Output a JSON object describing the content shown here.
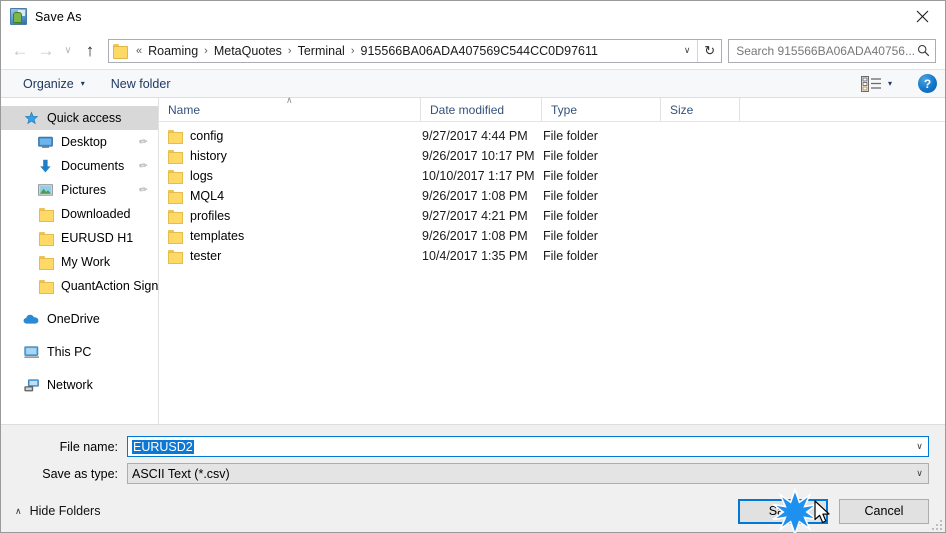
{
  "window": {
    "title": "Save As",
    "app_icon": "save-as-app-icon",
    "close_label": "✕"
  },
  "nav": {
    "back": "←",
    "forward": "→",
    "history": "∨",
    "up": "↑",
    "breadcrumb_prefix": "«",
    "breadcrumbs": [
      "Roaming",
      "MetaQuotes",
      "Terminal",
      "915566BA06ADA407569C544CC0D97611"
    ],
    "separator": "›",
    "dropdown": "∨",
    "refresh": "↻"
  },
  "search": {
    "placeholder": "Search 915566BA06ADA40756...",
    "icon": "search-icon"
  },
  "toolbar": {
    "organize": "Organize",
    "organize_caret": "▾",
    "new_folder": "New folder",
    "view_caret": "▾",
    "help": "?"
  },
  "sidebar": {
    "items": [
      {
        "label": "Quick access",
        "icon": "star-icon",
        "selected": true,
        "indent": false,
        "pinned": false
      },
      {
        "label": "Desktop",
        "icon": "monitor-icon",
        "selected": false,
        "indent": true,
        "pinned": true
      },
      {
        "label": "Documents",
        "icon": "download-arrow-icon",
        "selected": false,
        "indent": true,
        "pinned": true
      },
      {
        "label": "Pictures",
        "icon": "picture-icon",
        "selected": false,
        "indent": true,
        "pinned": true
      },
      {
        "label": "Downloaded",
        "icon": "folder-icon",
        "selected": false,
        "indent": true,
        "pinned": false
      },
      {
        "label": "EURUSD H1",
        "icon": "folder-icon",
        "selected": false,
        "indent": true,
        "pinned": false
      },
      {
        "label": "My Work",
        "icon": "folder-icon",
        "selected": false,
        "indent": true,
        "pinned": false
      },
      {
        "label": "QuantAction Signal",
        "icon": "folder-icon",
        "selected": false,
        "indent": true,
        "pinned": false
      }
    ],
    "groups": [
      {
        "label": "OneDrive",
        "icon": "onedrive-cloud-icon"
      },
      {
        "label": "This PC",
        "icon": "computer-icon"
      },
      {
        "label": "Network",
        "icon": "network-icon"
      }
    ],
    "pin_glyph": "✐"
  },
  "filelist": {
    "columns": [
      "Name",
      "Date modified",
      "Type",
      "Size"
    ],
    "sort_caret": "∧",
    "rows": [
      {
        "name": "config",
        "date": "9/27/2017 4:44 PM",
        "type": "File folder",
        "size": ""
      },
      {
        "name": "history",
        "date": "9/26/2017 10:17 PM",
        "type": "File folder",
        "size": ""
      },
      {
        "name": "logs",
        "date": "10/10/2017 1:17 PM",
        "type": "File folder",
        "size": ""
      },
      {
        "name": "MQL4",
        "date": "9/26/2017 1:08 PM",
        "type": "File folder",
        "size": ""
      },
      {
        "name": "profiles",
        "date": "9/27/2017 4:21 PM",
        "type": "File folder",
        "size": ""
      },
      {
        "name": "templates",
        "date": "9/26/2017 1:08 PM",
        "type": "File folder",
        "size": ""
      },
      {
        "name": "tester",
        "date": "10/4/2017 1:35 PM",
        "type": "File folder",
        "size": ""
      }
    ]
  },
  "form": {
    "filename_label": "File name:",
    "filename_value": "EURUSD2",
    "filetype_label": "Save as type:",
    "filetype_value": "ASCII Text (*.csv)",
    "chevron": "∨"
  },
  "footer": {
    "hide_folders": "Hide Folders",
    "hide_caret": "∧",
    "save": "Save",
    "cancel": "Cancel"
  },
  "colors": {
    "accent": "#0078d7",
    "selection": "#0a78d4",
    "crumb_text": "#1a1a1a",
    "toolbar_text": "#1f3864",
    "column_header": "#34517a",
    "folder_yellow": "#ffd966",
    "sidebar_selected": "#d8d8d8"
  }
}
